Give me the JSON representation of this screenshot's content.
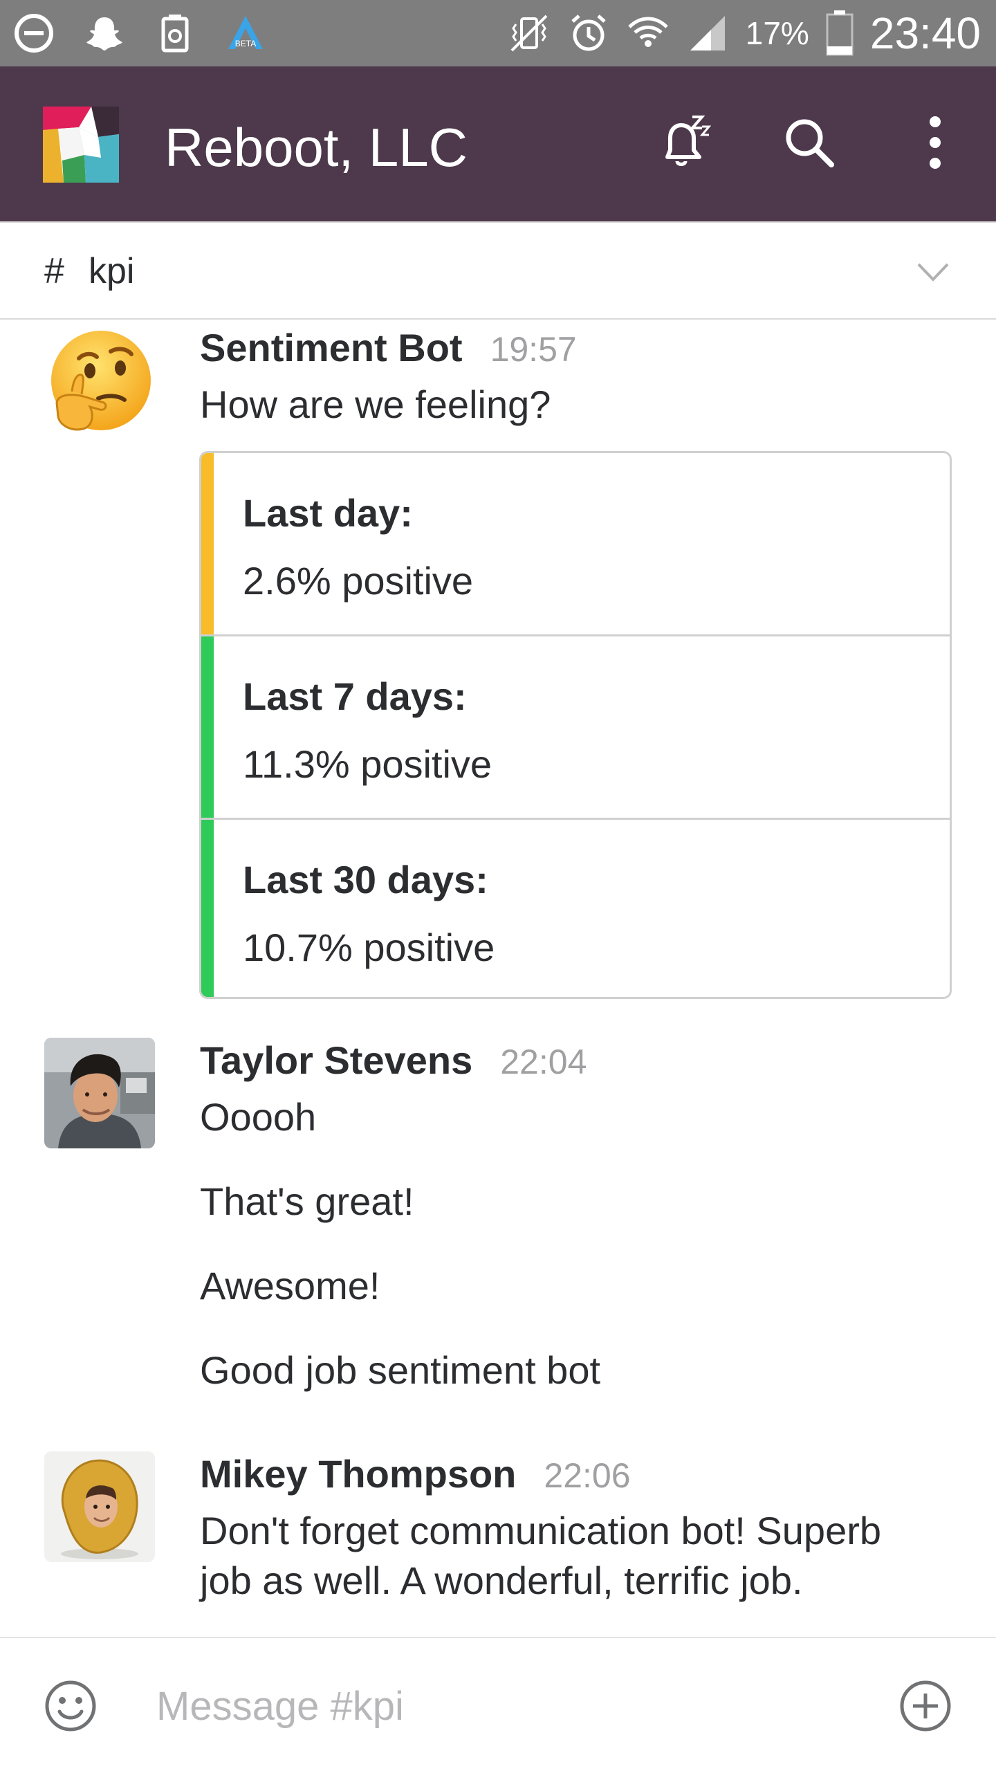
{
  "status_bar": {
    "icons": [
      "do-not-disturb-icon",
      "snapchat-icon",
      "recycle-icon",
      "beta-app-icon",
      "vibrate-icon",
      "alarm-icon",
      "wifi-icon",
      "signal-icon",
      "battery-icon"
    ],
    "beta_text": "BETA",
    "battery": "17%",
    "time": "23:40"
  },
  "app_bar": {
    "workspace_title": "Reboot, LLC",
    "actions": [
      "snooze-bell-icon",
      "search-icon",
      "more-vertical-icon"
    ],
    "color": "#4d394b"
  },
  "channel": {
    "hash": "#",
    "name": "kpi",
    "chevron": "chevron-down-icon"
  },
  "messages": [
    {
      "sender": "Sentiment Bot",
      "time": "19:57",
      "avatar": "thinking-face-emoji",
      "lines": [
        "How are we feeling?"
      ],
      "attachment": {
        "fields": [
          {
            "label": "Last day:",
            "value": "2.6% positive",
            "color": "#f7bc27"
          },
          {
            "label": "Last 7 days:",
            "value": "11.3% positive",
            "color": "#2eca5a"
          },
          {
            "label": "Last 30 days:",
            "value": "10.7% positive",
            "color": "#2eca5a"
          }
        ]
      }
    },
    {
      "sender": "Taylor Stevens",
      "time": "22:04",
      "avatar": "user-photo-avatar",
      "lines": [
        "Ooooh",
        "That's great!",
        "Awesome!",
        "Good job sentiment bot"
      ]
    },
    {
      "sender": "Mikey Thompson",
      "time": "22:06",
      "avatar": "nugget-photo-avatar",
      "lines": [
        "Don't forget communication bot! Superb",
        "job as well. A wonderful, terrific job."
      ]
    }
  ],
  "composer": {
    "placeholder": "Message #kpi",
    "value": "",
    "left_icon": "emoji-icon",
    "right_icon": "add-circle-icon"
  }
}
